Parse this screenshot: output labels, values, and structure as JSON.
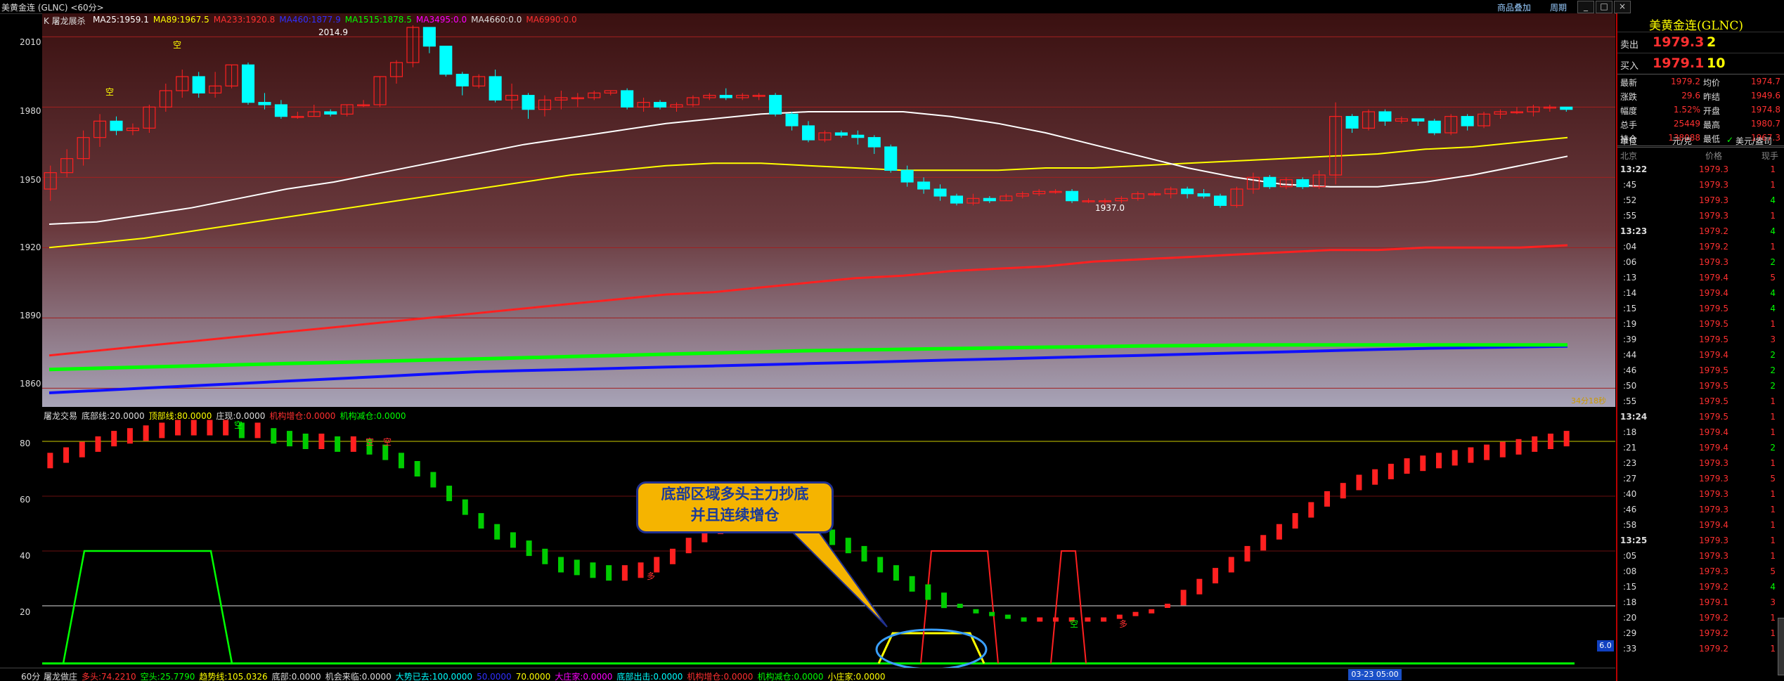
{
  "window": {
    "title": "美黄金连 (GLNC) <60分>",
    "toolbar": [
      "商品叠加",
      "周期"
    ],
    "win_buttons": [
      "_",
      "□",
      "×"
    ]
  },
  "colors": {
    "up": "#ff2020",
    "down": "#00ffff",
    "ma25": "#ffffff",
    "ma89": "#ffff00",
    "ma233": "#ff2020",
    "ma_blue": "#1010ff",
    "ma1515": "#00ff00"
  },
  "main_chart": {
    "title": "K 屠龙展杀",
    "ma_labels": [
      {
        "text": "MA25:1959.1",
        "color": "#ffffff"
      },
      {
        "text": "MA89:1967.5",
        "color": "#ffff00"
      },
      {
        "text": "MA233:1920.8",
        "color": "#ff3030"
      },
      {
        "text": "MA460:1877.9",
        "color": "#3030ff"
      },
      {
        "text": "MA1515:1878.5",
        "color": "#00ff00"
      },
      {
        "text": "MA3495:0.0",
        "color": "#ff00ff"
      },
      {
        "text": "MA4660:0.0",
        "color": "#dddddd"
      },
      {
        "text": "MA6990:0.0",
        "color": "#ff3030"
      }
    ],
    "y_axis": [
      "2010",
      "1980",
      "1950",
      "1920",
      "1890",
      "1860"
    ],
    "annotations": {
      "high": "2014.9",
      "low": "1937.0",
      "sig1": "空",
      "sig2": "空",
      "sig3": "空"
    },
    "footer": "34分18秒"
  },
  "chart_data": [
    {
      "type": "candlestick",
      "title": "",
      "ylim": [
        1852,
        2020
      ],
      "y_ticks": [
        2010,
        1980,
        1950,
        1920,
        1890,
        1860
      ],
      "candles": [
        [
          1945,
          1952,
          1940,
          1955
        ],
        [
          1952,
          1958,
          1950,
          1962
        ],
        [
          1958,
          1967,
          1955,
          1970
        ],
        [
          1967,
          1974,
          1963,
          1977
        ],
        [
          1974,
          1970,
          1968,
          1976
        ],
        [
          1970,
          1971,
          1968,
          1973
        ],
        [
          1971,
          1980,
          1969,
          1981
        ],
        [
          1980,
          1987,
          1978,
          1990
        ],
        [
          1987,
          1993,
          1984,
          1996
        ],
        [
          1993,
          1986,
          1984,
          1995
        ],
        [
          1986,
          1989,
          1984,
          1995
        ],
        [
          1989,
          1998,
          1988,
          1998
        ],
        [
          1998,
          1982,
          1981,
          1999
        ],
        [
          1982,
          1981,
          1979,
          1986
        ],
        [
          1981,
          1976,
          1975,
          1983
        ],
        [
          1976,
          1976,
          1975,
          1978
        ],
        [
          1976,
          1978,
          1976,
          1981
        ],
        [
          1978,
          1977,
          1976,
          1979
        ],
        [
          1977,
          1981,
          1976,
          1981
        ],
        [
          1981,
          1981,
          1980,
          1983
        ],
        [
          1981,
          1993,
          1980,
          1993
        ],
        [
          1993,
          1999,
          1990,
          2000
        ],
        [
          1999,
          2014,
          1997,
          2014.9
        ],
        [
          2014,
          2006,
          2003,
          2014
        ],
        [
          2006,
          1994,
          1993,
          2006
        ],
        [
          1994,
          1989,
          1985,
          1995
        ],
        [
          1989,
          1993,
          1988,
          1994
        ],
        [
          1993,
          1983,
          1982,
          1996
        ],
        [
          1983,
          1985,
          1979,
          1990
        ],
        [
          1985,
          1979,
          1975,
          1986
        ],
        [
          1979,
          1983,
          1976,
          1985
        ],
        [
          1983,
          1984,
          1979,
          1987
        ],
        [
          1984,
          1984,
          1980,
          1986
        ],
        [
          1984,
          1986,
          1983,
          1987
        ],
        [
          1986,
          1987,
          1985,
          1987
        ],
        [
          1987,
          1980,
          1979,
          1988
        ],
        [
          1980,
          1982,
          1978,
          1984
        ],
        [
          1982,
          1980,
          1979,
          1983
        ],
        [
          1980,
          1981,
          1978,
          1982
        ],
        [
          1981,
          1984,
          1980,
          1985
        ],
        [
          1984,
          1985,
          1983,
          1986
        ],
        [
          1985,
          1984,
          1983,
          1988
        ],
        [
          1984,
          1985,
          1983,
          1986
        ],
        [
          1985,
          1985,
          1983,
          1986
        ],
        [
          1985,
          1977,
          1976,
          1986
        ],
        [
          1977,
          1972,
          1970,
          1978
        ],
        [
          1972,
          1966,
          1965,
          1974
        ],
        [
          1966,
          1969,
          1965,
          1970
        ],
        [
          1969,
          1968,
          1967,
          1970
        ],
        [
          1968,
          1967,
          1964,
          1970
        ],
        [
          1967,
          1963,
          1960,
          1968
        ],
        [
          1963,
          1953,
          1952,
          1964
        ],
        [
          1953,
          1948,
          1946,
          1955
        ],
        [
          1948,
          1945,
          1943,
          1950
        ],
        [
          1945,
          1942,
          1940,
          1947
        ],
        [
          1942,
          1939,
          1938,
          1943
        ],
        [
          1939,
          1941,
          1938,
          1943
        ],
        [
          1941,
          1940,
          1939,
          1942
        ],
        [
          1940,
          1942,
          1940,
          1943
        ],
        [
          1942,
          1943,
          1941,
          1944
        ],
        [
          1943,
          1944,
          1942,
          1945
        ],
        [
          1944,
          1944,
          1943,
          1945
        ],
        [
          1944,
          1940,
          1939,
          1945
        ],
        [
          1940,
          1940,
          1939,
          1941
        ],
        [
          1940,
          1940,
          1937,
          1941
        ],
        [
          1940,
          1941,
          1939,
          1942
        ],
        [
          1941,
          1943,
          1940,
          1944
        ],
        [
          1943,
          1943,
          1942,
          1944
        ],
        [
          1943,
          1945,
          1941,
          1946
        ],
        [
          1945,
          1943,
          1941,
          1946
        ],
        [
          1943,
          1942,
          1941,
          1945
        ],
        [
          1942,
          1938,
          1937,
          1943
        ],
        [
          1938,
          1945,
          1937,
          1946
        ],
        [
          1945,
          1950,
          1943,
          1952
        ],
        [
          1950,
          1946,
          1945,
          1951
        ],
        [
          1946,
          1949,
          1945,
          1950
        ],
        [
          1949,
          1946,
          1945,
          1950
        ],
        [
          1946,
          1951,
          1945,
          1953
        ],
        [
          1951,
          1976,
          1947,
          1982
        ],
        [
          1976,
          1971,
          1969,
          1977
        ],
        [
          1971,
          1978,
          1970,
          1979
        ],
        [
          1978,
          1974,
          1972,
          1979
        ],
        [
          1974,
          1975,
          1973,
          1976
        ],
        [
          1975,
          1974,
          1972,
          1975
        ],
        [
          1974,
          1969,
          1968,
          1975
        ],
        [
          1969,
          1976,
          1968,
          1977
        ],
        [
          1976,
          1972,
          1970,
          1977
        ],
        [
          1972,
          1977,
          1971,
          1978
        ],
        [
          1977,
          1978,
          1975,
          1979
        ],
        [
          1978,
          1978,
          1977,
          1980
        ],
        [
          1978,
          1980,
          1976,
          1981
        ],
        [
          1980,
          1980,
          1978,
          1981
        ],
        [
          1980,
          1979,
          1978,
          1980
        ]
      ],
      "ma25": [
        1930,
        1931,
        1934,
        1937,
        1941,
        1945,
        1948,
        1952,
        1956,
        1960,
        1964,
        1967,
        1970,
        1973,
        1975,
        1977,
        1978,
        1978,
        1978,
        1976,
        1973,
        1969,
        1964,
        1959,
        1954,
        1950,
        1947,
        1946,
        1946,
        1948,
        1951,
        1955,
        1959
      ],
      "ma89": [
        1920,
        1922,
        1924,
        1927,
        1930,
        1933,
        1936,
        1939,
        1942,
        1945,
        1948,
        1951,
        1953,
        1955,
        1956,
        1956,
        1955,
        1954,
        1953,
        1953,
        1953,
        1954,
        1954,
        1955,
        1956,
        1957,
        1958,
        1959,
        1960,
        1962,
        1963,
        1965,
        1967
      ],
      "ma233": [
        1874,
        1876,
        1878,
        1880,
        1882,
        1884,
        1886,
        1888,
        1890,
        1892,
        1894,
        1896,
        1898,
        1900,
        1901,
        1903,
        1905,
        1907,
        1908,
        1910,
        1911,
        1912,
        1914,
        1915,
        1916,
        1917,
        1918,
        1919,
        1919,
        1920,
        1920,
        1920,
        1921
      ],
      "ma1515": [
        1868,
        1868.5,
        1869,
        1869.5,
        1870,
        1870.5,
        1871,
        1871.5,
        1872,
        1872.5,
        1873,
        1873.5,
        1874,
        1874.5,
        1875,
        1875.5,
        1876,
        1876.3,
        1876.6,
        1876.9,
        1877.2,
        1877.5,
        1877.7,
        1878,
        1878.2,
        1878.4,
        1878.5,
        1878.5,
        1878.5,
        1878.5,
        1878.5,
        1878.5,
        1878.5
      ],
      "ma460": [
        1858,
        1859,
        1860,
        1861,
        1862,
        1863,
        1864,
        1865,
        1866,
        1867,
        1867.5,
        1868,
        1868.5,
        1869,
        1869.5,
        1870,
        1870.5,
        1871,
        1871.5,
        1872,
        1872.5,
        1873,
        1873.5,
        1874,
        1874.5,
        1875,
        1875.5,
        1876,
        1876.5,
        1877,
        1877.3,
        1877.6,
        1877.9
      ]
    },
    {
      "type": "indicator",
      "title": "",
      "ylim": [
        0,
        90
      ],
      "y_ticks": [
        80,
        60,
        40,
        20
      ],
      "bar_values": [
        73,
        75,
        77,
        79,
        81,
        82,
        83,
        84,
        85,
        85,
        85,
        85,
        84,
        84,
        82,
        81,
        80,
        80,
        79,
        79,
        78,
        76,
        73,
        70,
        66,
        61,
        56,
        51,
        47,
        44,
        41,
        38,
        35,
        34,
        33,
        32,
        32,
        33,
        35,
        38,
        42,
        46,
        49,
        50,
        50,
        50,
        51,
        49,
        47,
        45,
        42,
        39,
        35,
        32,
        28,
        25,
        22,
        20,
        18,
        17,
        16,
        15,
        15,
        15,
        15,
        15,
        15,
        16,
        17,
        18,
        20,
        23,
        27,
        31,
        35,
        39,
        43,
        47,
        51,
        55,
        59,
        62,
        65,
        67,
        69,
        71,
        72,
        73,
        74,
        75,
        76,
        77,
        78,
        79,
        80,
        81
      ],
      "white_line": 80,
      "gray_line": 20
    }
  ],
  "indicator": {
    "title": "屠龙交易",
    "labels": [
      {
        "text": "底部线:20.0000",
        "color": "#dddddd"
      },
      {
        "text": "顶部线:80.0000",
        "color": "#ffff00"
      },
      {
        "text": "庄现:0.0000",
        "color": "#dddddd"
      },
      {
        "text": "机构增仓:0.0000",
        "color": "#ff3030"
      },
      {
        "text": "机构减仓:0.0000",
        "color": "#00ff00"
      }
    ],
    "y_axis": [
      "80",
      "60",
      "40",
      "20"
    ],
    "signals": [
      "空",
      "空",
      "空",
      "空",
      "多",
      "多"
    ],
    "callout": [
      "底部区域多头主力抄底",
      "并且连续增仓"
    ],
    "right_badge": "6.0"
  },
  "bottom_bar": {
    "period": "60分",
    "label": "屠龙做庄",
    "values": [
      {
        "text": "多头:74.2210",
        "color": "#ff3030"
      },
      {
        "text": "空头:25.7790",
        "color": "#00ff00"
      },
      {
        "text": "趋势线:105.0326",
        "color": "#ffff00"
      },
      {
        "text": "底部:0.0000",
        "color": "#dddddd"
      },
      {
        "text": "机会来临:0.0000",
        "color": "#dddddd"
      },
      {
        "text": "大势已去:100.0000",
        "color": "#00ffff"
      },
      {
        "text": "50.0000",
        "color": "#3030ff"
      },
      {
        "text": "70.0000",
        "color": "#ffff00"
      },
      {
        "text": "大庄家:0.0000",
        "color": "#ff00ff"
      },
      {
        "text": "底部出击:0.0000",
        "color": "#00ffff"
      },
      {
        "text": "机构增仓:0.0000",
        "color": "#ff3030"
      },
      {
        "text": "机构减仓:0.0000",
        "color": "#00ff00"
      },
      {
        "text": "小庄家:0.0000",
        "color": "#ffff00"
      }
    ],
    "time_badge": "03-23 05:00",
    "corner": "笔"
  },
  "quote_panel": {
    "name": "美黄金连(GLNC)",
    "sell": {
      "label": "卖出",
      "price": "1979.3",
      "qty": "2"
    },
    "buy": {
      "label": "买入",
      "price": "1979.1",
      "qty": "10"
    },
    "stats": [
      {
        "l1": "最新",
        "v1": "1979.2",
        "l2": "均价",
        "v2": "1974.7"
      },
      {
        "l1": "涨跌",
        "v1": "29.6",
        "l2": "昨结",
        "v2": "1949.6"
      },
      {
        "l1": "幅度",
        "v1": "1.52%",
        "l2": "开盘",
        "v2": "1974.8"
      },
      {
        "l1": "总手",
        "v1": "25449",
        "l2": "最高",
        "v2": "1980.7"
      },
      {
        "l1": "持仓",
        "v1": "138088",
        "l2": "最低",
        "v2": "1967.3"
      }
    ],
    "unit": {
      "label": "单位",
      "value": "元/克",
      "alt": "美元/盎司"
    },
    "columns": [
      "北京",
      "价格",
      "现手"
    ],
    "trades": [
      {
        "t": "13:22",
        "p": "1979.3",
        "q": "1",
        "bold": true
      },
      {
        "t": ":45",
        "p": "1979.3",
        "q": "1"
      },
      {
        "t": ":52",
        "p": "1979.3",
        "q": "4"
      },
      {
        "t": ":55",
        "p": "1979.3",
        "q": "1"
      },
      {
        "t": "13:23",
        "p": "1979.2",
        "q": "4",
        "bold": true
      },
      {
        "t": ":04",
        "p": "1979.2",
        "q": "1"
      },
      {
        "t": ":06",
        "p": "1979.3",
        "q": "2"
      },
      {
        "t": ":13",
        "p": "1979.4",
        "q": "5"
      },
      {
        "t": ":14",
        "p": "1979.4",
        "q": "4"
      },
      {
        "t": ":15",
        "p": "1979.5",
        "q": "4"
      },
      {
        "t": ":19",
        "p": "1979.5",
        "q": "1"
      },
      {
        "t": ":39",
        "p": "1979.5",
        "q": "3"
      },
      {
        "t": ":44",
        "p": "1979.4",
        "q": "2"
      },
      {
        "t": ":46",
        "p": "1979.5",
        "q": "2"
      },
      {
        "t": ":50",
        "p": "1979.5",
        "q": "2"
      },
      {
        "t": ":55",
        "p": "1979.5",
        "q": "1"
      },
      {
        "t": "13:24",
        "p": "1979.5",
        "q": "1",
        "bold": true
      },
      {
        "t": ":18",
        "p": "1979.4",
        "q": "1"
      },
      {
        "t": ":21",
        "p": "1979.4",
        "q": "2"
      },
      {
        "t": ":23",
        "p": "1979.3",
        "q": "1"
      },
      {
        "t": ":27",
        "p": "1979.3",
        "q": "5"
      },
      {
        "t": ":40",
        "p": "1979.3",
        "q": "1"
      },
      {
        "t": ":46",
        "p": "1979.3",
        "q": "1"
      },
      {
        "t": ":58",
        "p": "1979.4",
        "q": "1"
      },
      {
        "t": "13:25",
        "p": "1979.3",
        "q": "1",
        "bold": true
      },
      {
        "t": ":05",
        "p": "1979.3",
        "q": "1"
      },
      {
        "t": ":08",
        "p": "1979.3",
        "q": "5"
      },
      {
        "t": ":15",
        "p": "1979.2",
        "q": "4"
      },
      {
        "t": ":18",
        "p": "1979.1",
        "q": "3"
      },
      {
        "t": ":20",
        "p": "1979.2",
        "q": "1"
      },
      {
        "t": ":29",
        "p": "1979.2",
        "q": "1"
      },
      {
        "t": ":33",
        "p": "1979.2",
        "q": "1"
      }
    ]
  }
}
